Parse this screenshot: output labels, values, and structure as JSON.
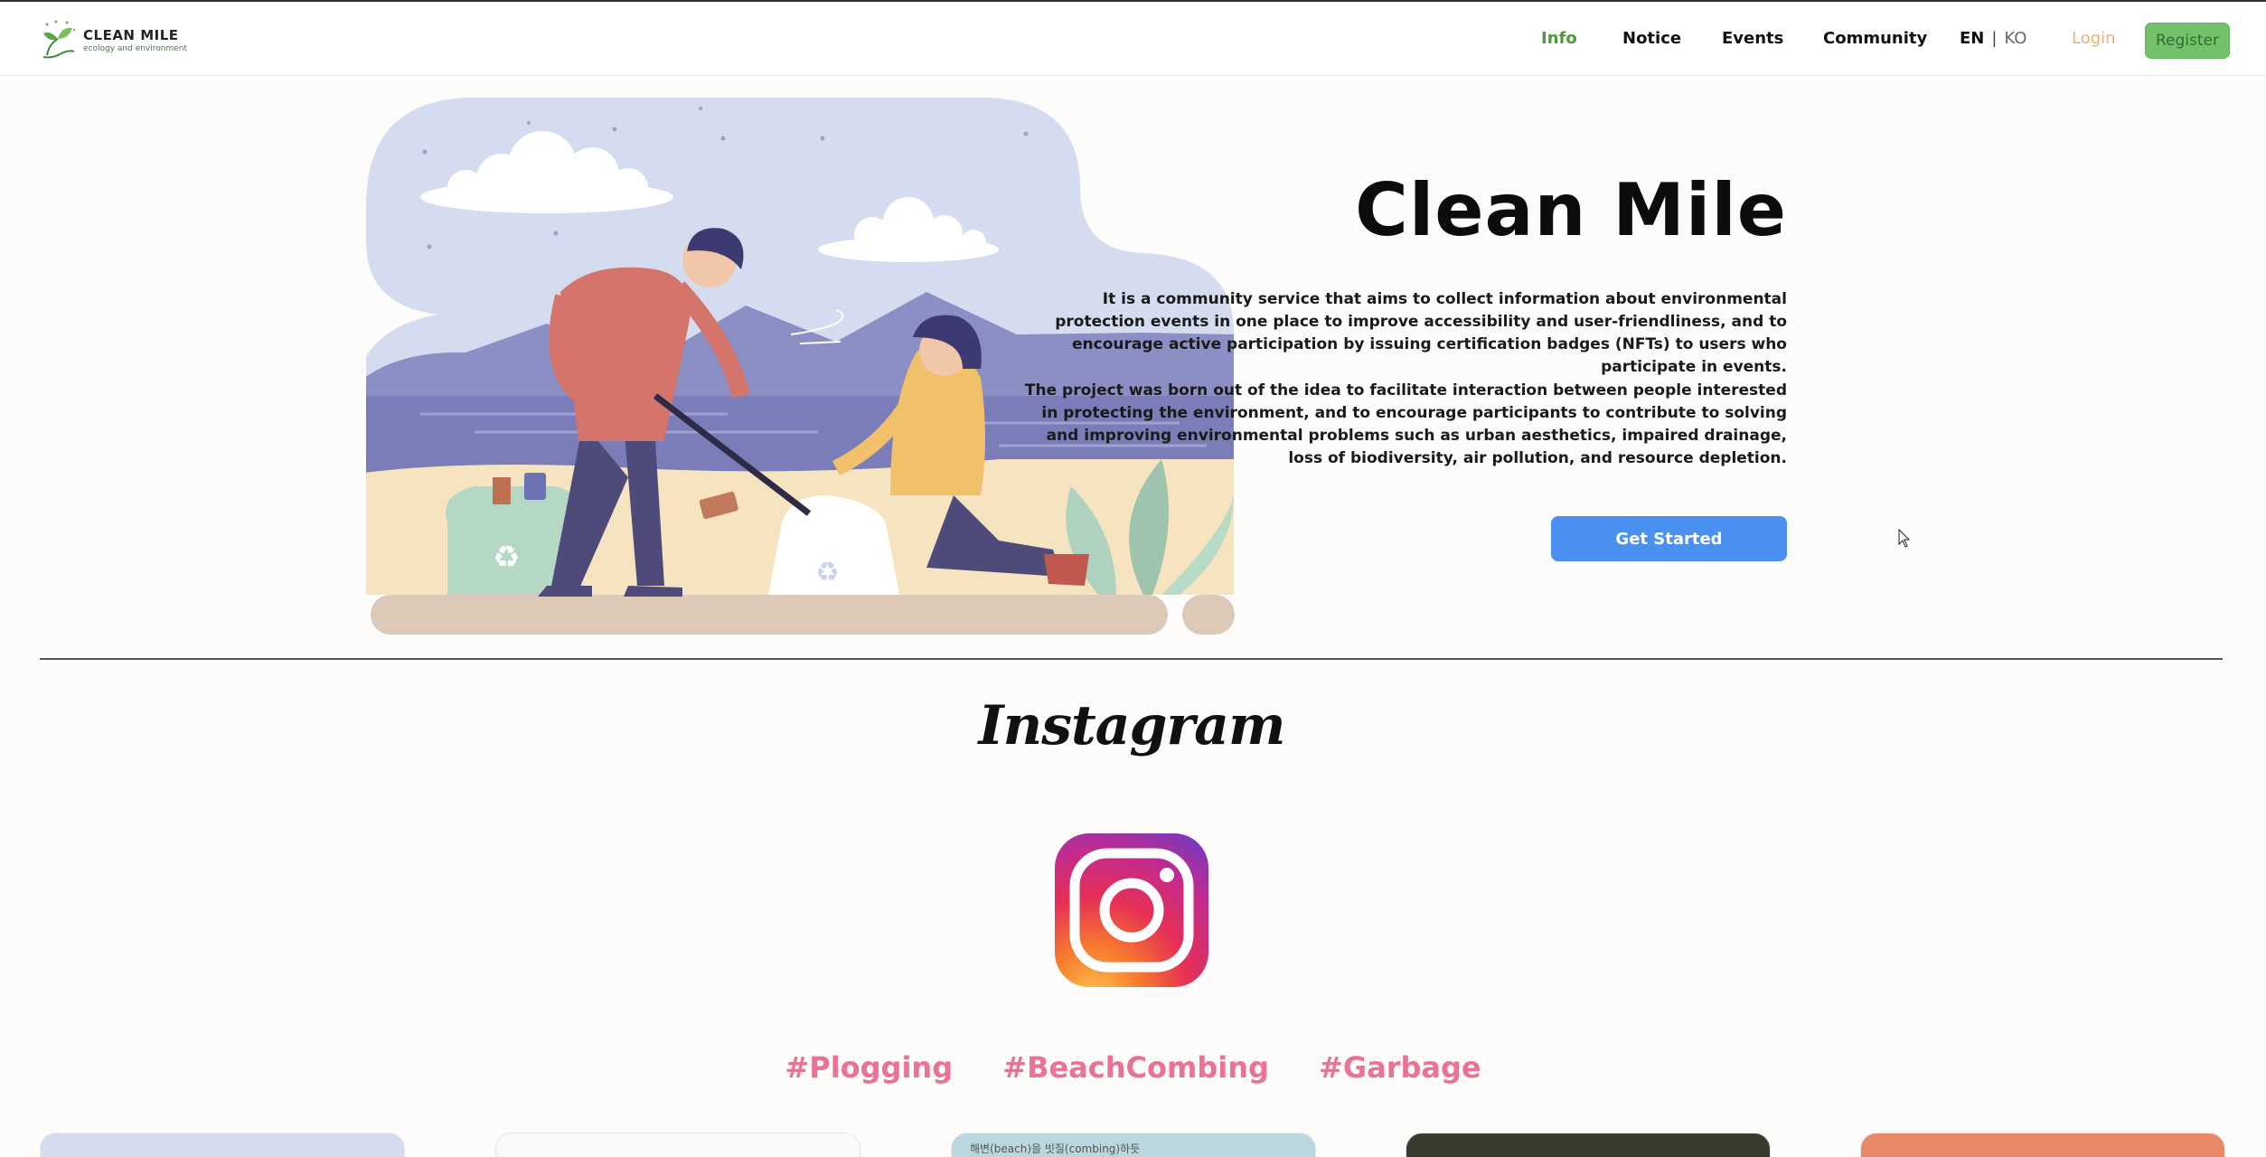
{
  "app": {
    "name": "CLEAN MILE",
    "tagline": "ecology and environment"
  },
  "nav": {
    "info": "Info",
    "notice": "Notice",
    "events": "Events",
    "community": "Community"
  },
  "lang": {
    "en": "EN",
    "sep": "|",
    "ko": "KO"
  },
  "auth": {
    "login": "Login",
    "register": "Register"
  },
  "hero": {
    "title": "Clean Mile",
    "p1": "It is a community service that aims to collect information about environmental protection events in one place to improve accessibility and user-friendliness, and to encourage active participation by issuing certification badges (NFTs) to users who participate in events.",
    "p2": "The project was born out of the idea to facilitate interaction between people interested in protecting the environment, and to encourage participants to contribute to solving and improving environmental problems such as urban aesthetics, impaired drainage, loss of biodiversity, air pollution, and resource depletion.",
    "cta": "Get Started"
  },
  "instagram": {
    "wordmark": "Instagram",
    "tags": [
      "#Plogging",
      "#BeachCombing",
      "#Garbage"
    ],
    "cards": [
      {
        "caption": ""
      },
      {
        "caption": ""
      },
      {
        "caption": "해변(beach)을 빗질(combing)하듯"
      },
      {
        "caption": ""
      },
      {
        "caption": ""
      }
    ]
  },
  "colors": {
    "nav_active": "#4c9a3a",
    "login": "#e8b07c",
    "register_bg": "#73c26b",
    "cta_bg": "#4a90f0",
    "hashtag": "#ec7196"
  }
}
